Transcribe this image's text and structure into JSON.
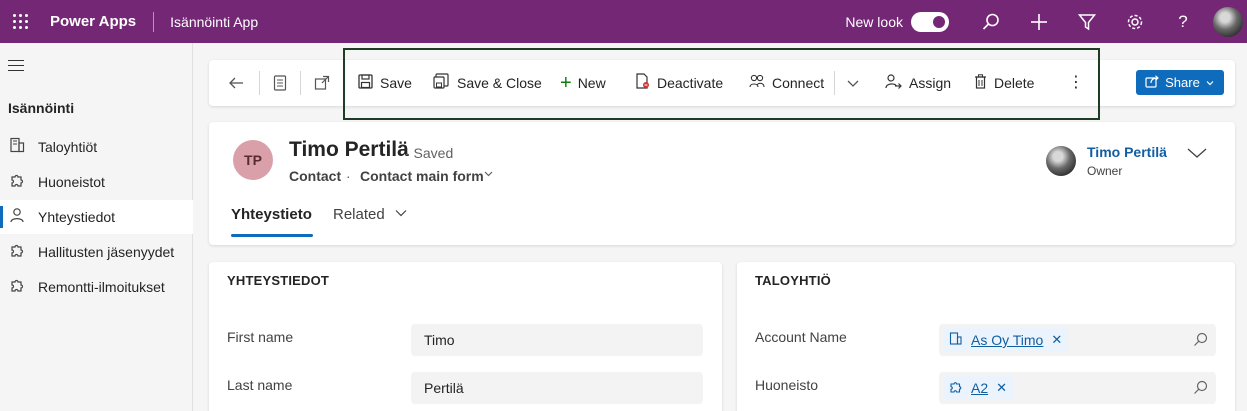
{
  "topbar": {
    "brand": "Power Apps",
    "app_name": "Isännöinti App",
    "new_look_label": "New look",
    "icons": [
      "waffle-icon",
      "search-icon",
      "plus-icon",
      "filter-icon",
      "gear-icon",
      "help-icon"
    ]
  },
  "sidebar": {
    "section_title": "Isännöinti",
    "items": [
      {
        "label": "Taloyhtiöt",
        "icon": "building-icon"
      },
      {
        "label": "Huoneistot",
        "icon": "puzzle-icon"
      },
      {
        "label": "Yhteystiedot",
        "icon": "person-icon",
        "active": true
      },
      {
        "label": "Hallitusten jäsenyydet",
        "icon": "puzzle-icon"
      },
      {
        "label": "Remontti-ilmoitukset",
        "icon": "puzzle-icon"
      }
    ]
  },
  "commandbar": {
    "save": "Save",
    "save_close": "Save & Close",
    "new": "New",
    "deactivate": "Deactivate",
    "connect": "Connect",
    "assign": "Assign",
    "delete": "Delete",
    "share": "Share"
  },
  "record": {
    "initials": "TP",
    "name": "Timo Pertilä",
    "status": "- Saved",
    "entity": "Contact",
    "separator": "·",
    "form": "Contact main form",
    "owner_name": "Timo Pertilä",
    "owner_role": "Owner"
  },
  "tabs": {
    "active": "Yhteystieto",
    "related": "Related"
  },
  "section_left": {
    "title": "YHTEYSTIEDOT",
    "fields": [
      {
        "label": "First name",
        "value": "Timo"
      },
      {
        "label": "Last name",
        "value": "Pertilä"
      }
    ]
  },
  "section_right": {
    "title": "TALOYHTIÖ",
    "fields": [
      {
        "label": "Account Name",
        "value": "As Oy Timo"
      },
      {
        "label": "Huoneisto",
        "value": "A2"
      }
    ]
  },
  "colors": {
    "topbar": "#742774",
    "accent": "#0f6cbd",
    "highlight_frame": "#1f3d25"
  }
}
